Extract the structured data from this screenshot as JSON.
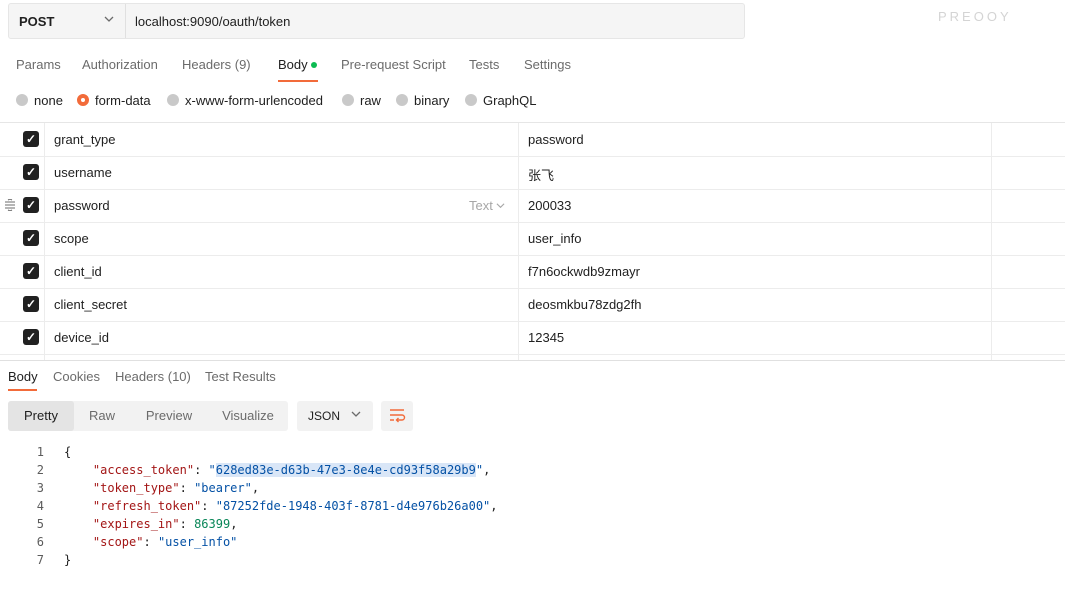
{
  "request": {
    "method": "POST",
    "url": "localhost:9090/oauth/token",
    "top_right_text": "PREOOY"
  },
  "tabs": [
    {
      "label": "Params"
    },
    {
      "label": "Authorization"
    },
    {
      "label": "Headers (9)"
    },
    {
      "label": "Body"
    },
    {
      "label": "Pre-request Script"
    },
    {
      "label": "Tests"
    },
    {
      "label": "Settings"
    }
  ],
  "body_types": [
    {
      "label": "none",
      "selected": false
    },
    {
      "label": "form-data",
      "selected": true
    },
    {
      "label": "x-www-form-urlencoded",
      "selected": false
    },
    {
      "label": "raw",
      "selected": false
    },
    {
      "label": "binary",
      "selected": false
    },
    {
      "label": "GraphQL",
      "selected": false
    }
  ],
  "params": [
    {
      "key": "grant_type",
      "value": "password",
      "checked": true
    },
    {
      "key": "username",
      "value": "张飞",
      "checked": true
    },
    {
      "key": "password",
      "value": "200033",
      "checked": true,
      "type_label": "Text"
    },
    {
      "key": "scope",
      "value": "user_info",
      "checked": true
    },
    {
      "key": "client_id",
      "value": "f7n6ockwdb9zmayr",
      "checked": true
    },
    {
      "key": "client_secret",
      "value": "deosmkbu78zdg2fh",
      "checked": true
    },
    {
      "key": "device_id",
      "value": "12345",
      "checked": true
    }
  ],
  "response_tabs": [
    {
      "label": "Body"
    },
    {
      "label": "Cookies"
    },
    {
      "label": "Headers (10)"
    },
    {
      "label": "Test Results"
    }
  ],
  "format_options": [
    {
      "label": "Pretty"
    },
    {
      "label": "Raw"
    },
    {
      "label": "Preview"
    },
    {
      "label": "Visualize"
    }
  ],
  "language": "JSON",
  "response": {
    "line_numbers": [
      "1",
      "2",
      "3",
      "4",
      "5",
      "6",
      "7"
    ],
    "open_brace": "{",
    "close_brace": "}",
    "access_token_key": "\"access_token\"",
    "access_token_value": "628ed83e-d63b-47e3-8e4e-cd93f58a29b9",
    "token_type_key": "\"token_type\"",
    "token_type_value": "\"bearer\"",
    "refresh_token_key": "\"refresh_token\"",
    "refresh_token_value": "\"87252fde-1948-403f-8781-d4e976b26a00\"",
    "expires_in_key": "\"expires_in\"",
    "expires_in_value": "86399",
    "scope_key": "\"scope\"",
    "scope_value": "\"user_info\""
  },
  "colors": {
    "accent": "#f26b3a",
    "body_dot": "#0cbb52",
    "json_key": "#a31515",
    "json_string": "#0451a5",
    "json_number": "#098658"
  },
  "icons": [
    "chevron-down-icon",
    "checkbox-checked-icon",
    "drag-handle-icon",
    "wrap-lines-icon"
  ]
}
